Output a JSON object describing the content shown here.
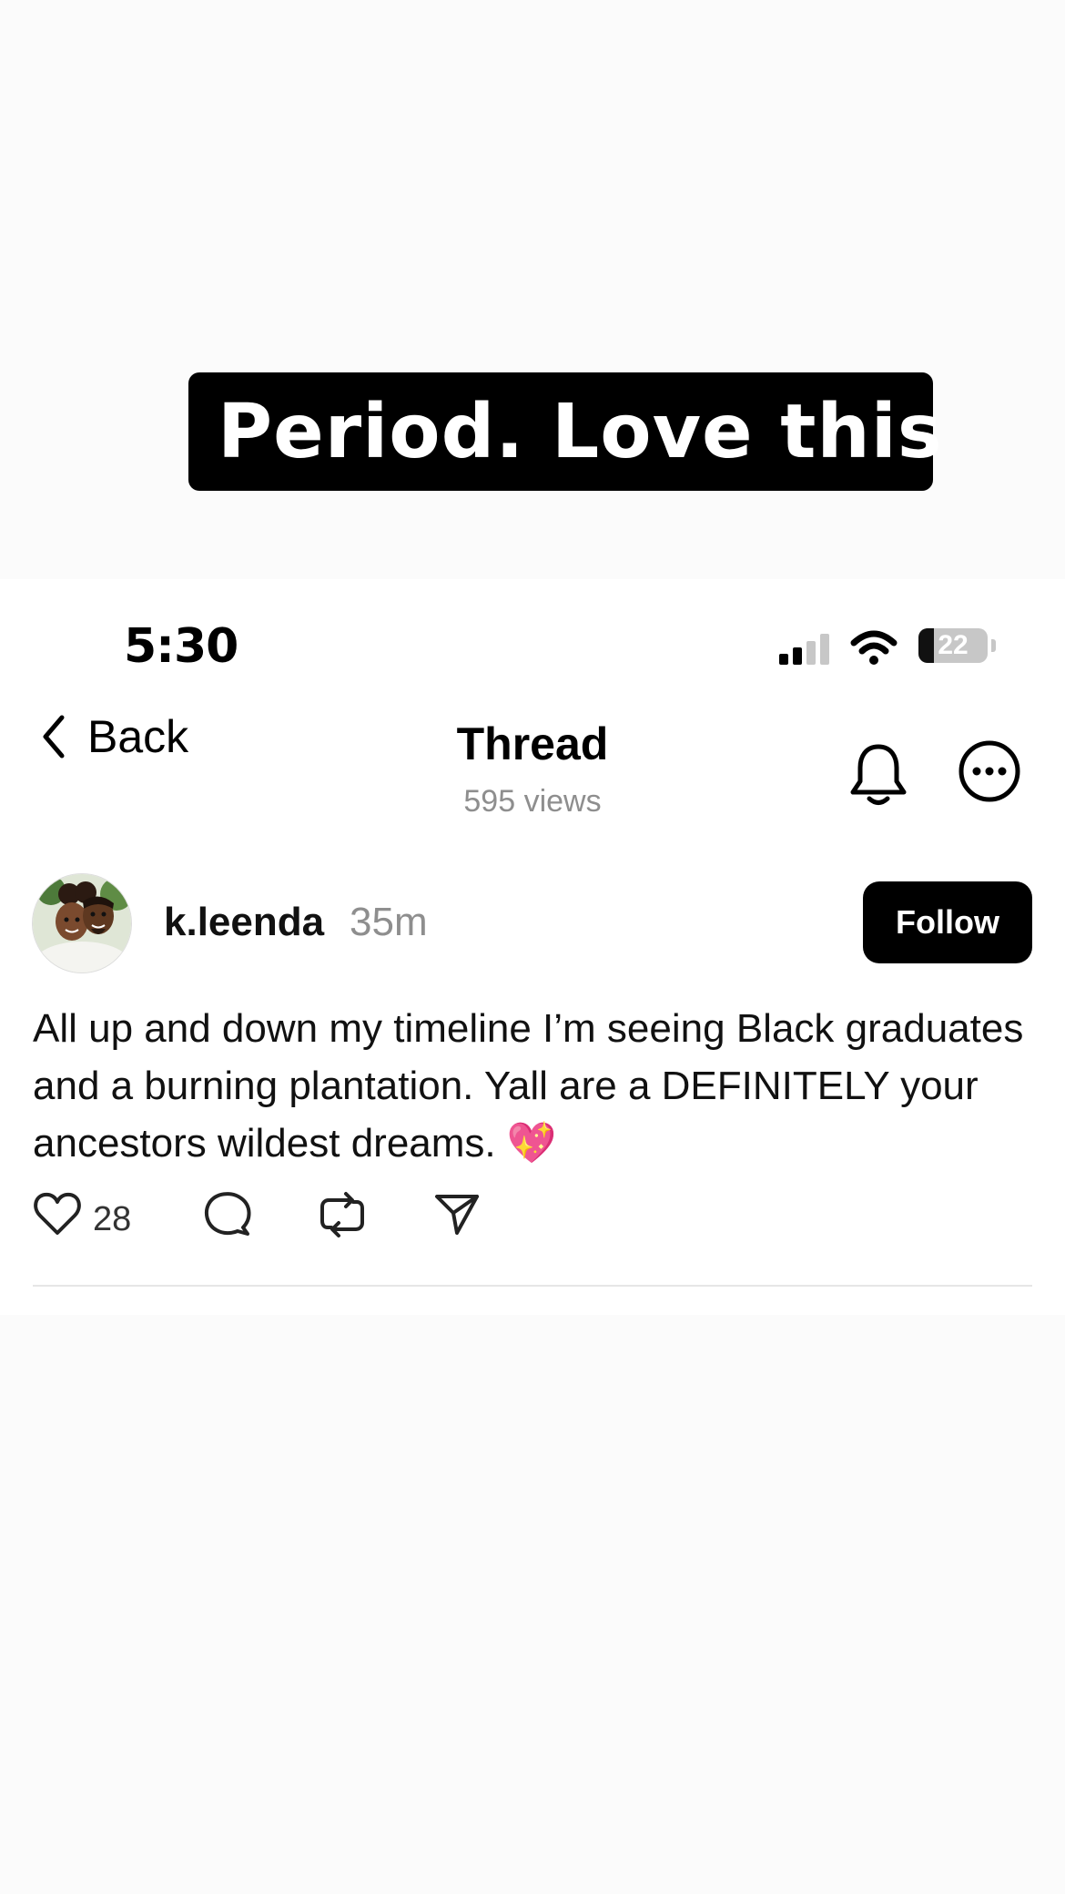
{
  "overlay_caption": "Period. Love this",
  "status_bar": {
    "time": "5:30",
    "battery_level": "22"
  },
  "nav": {
    "back_label": "Back",
    "title": "Thread",
    "views": "595 views"
  },
  "post": {
    "username": "k.leenda",
    "time": "35m",
    "follow_label": "Follow",
    "text": "All up and down my timeline I’m seeing Black graduates and a burning plantation. Yall are a DEFINITELY your ancestors wildest dreams. 💖",
    "like_count": "28"
  },
  "colors": {
    "accent": "#000000",
    "muted": "#8e8e8e",
    "divider": "#e6e6e6"
  },
  "icons": [
    "chevron-left-icon",
    "bell-icon",
    "more-icon",
    "heart-icon",
    "comment-icon",
    "repost-icon",
    "share-icon",
    "signal-icon",
    "wifi-icon",
    "battery-icon"
  ]
}
